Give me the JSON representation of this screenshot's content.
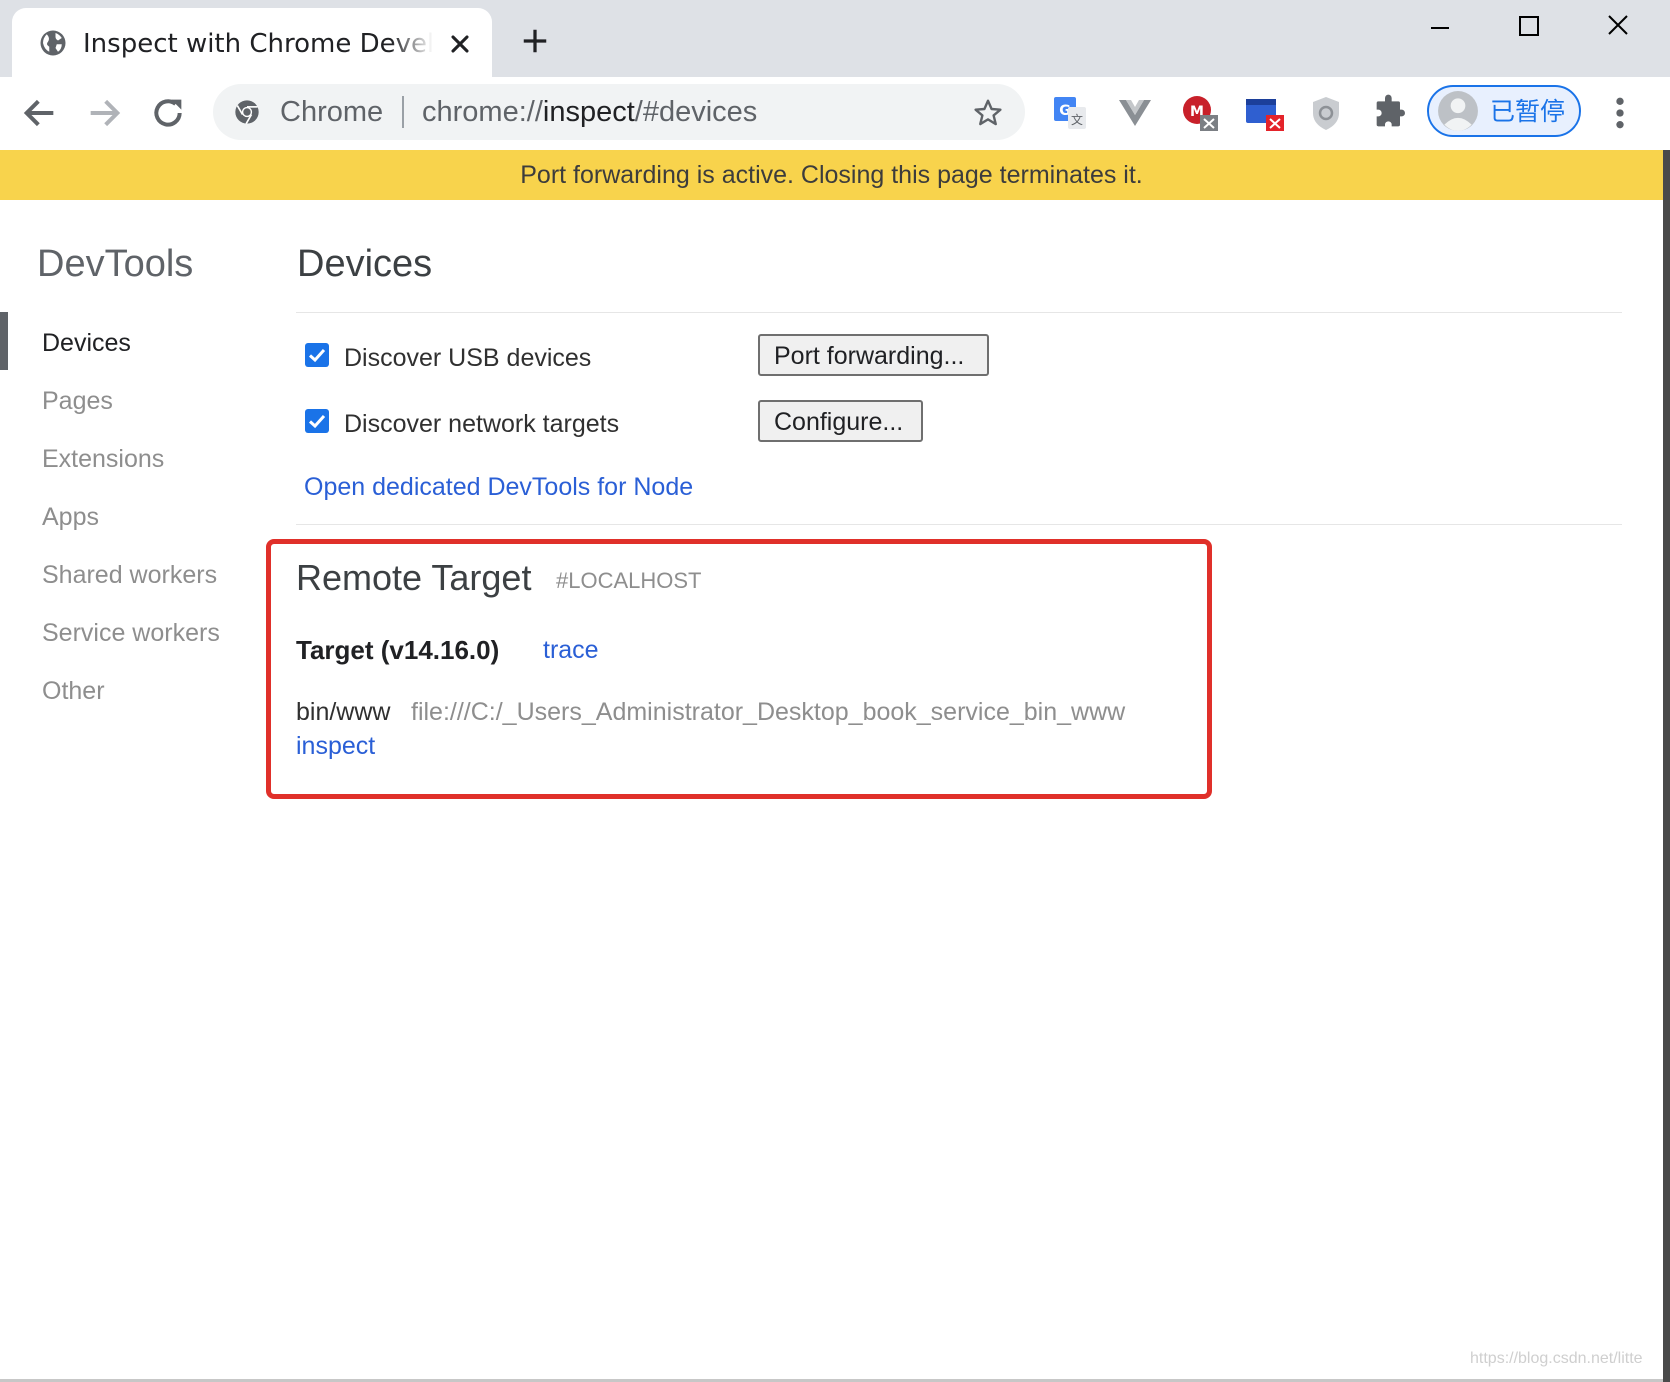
{
  "browser": {
    "tab_title": "Inspect with Chrome Developer Tools",
    "omnibox": {
      "chip": "Chrome",
      "url_scheme": "chrome://",
      "url_host": "inspect",
      "url_path": "/#devices"
    },
    "profile_label": "已暂停"
  },
  "infobar": {
    "message": "Port forwarding is active. Closing this page terminates it."
  },
  "sidebar": {
    "title": "DevTools",
    "items": [
      {
        "label": "Devices",
        "selected": true
      },
      {
        "label": "Pages",
        "selected": false
      },
      {
        "label": "Extensions",
        "selected": false
      },
      {
        "label": "Apps",
        "selected": false
      },
      {
        "label": "Shared workers",
        "selected": false
      },
      {
        "label": "Service workers",
        "selected": false
      },
      {
        "label": "Other",
        "selected": false
      }
    ]
  },
  "main": {
    "title": "Devices",
    "discover_usb": {
      "label": "Discover USB devices",
      "checked": true
    },
    "discover_network": {
      "label": "Discover network targets",
      "checked": true
    },
    "port_forwarding_button": "Port forwarding...",
    "configure_button": "Configure...",
    "node_devtools_link": "Open dedicated DevTools for Node",
    "remote_target": {
      "title": "Remote Target",
      "host": "#LOCALHOST",
      "target_name": "Target (v14.16.0)",
      "trace_link": "trace",
      "path": "bin/www",
      "url": "file:///C:/_Users_Administrator_Desktop_book_service_bin_www",
      "inspect_link": "inspect"
    }
  },
  "watermark": "https://blog.csdn.net/litte",
  "colors": {
    "infobar": "#f8d34c",
    "highlight": "#e0302a",
    "link": "#2a5fd6",
    "accent": "#1a73e8"
  }
}
